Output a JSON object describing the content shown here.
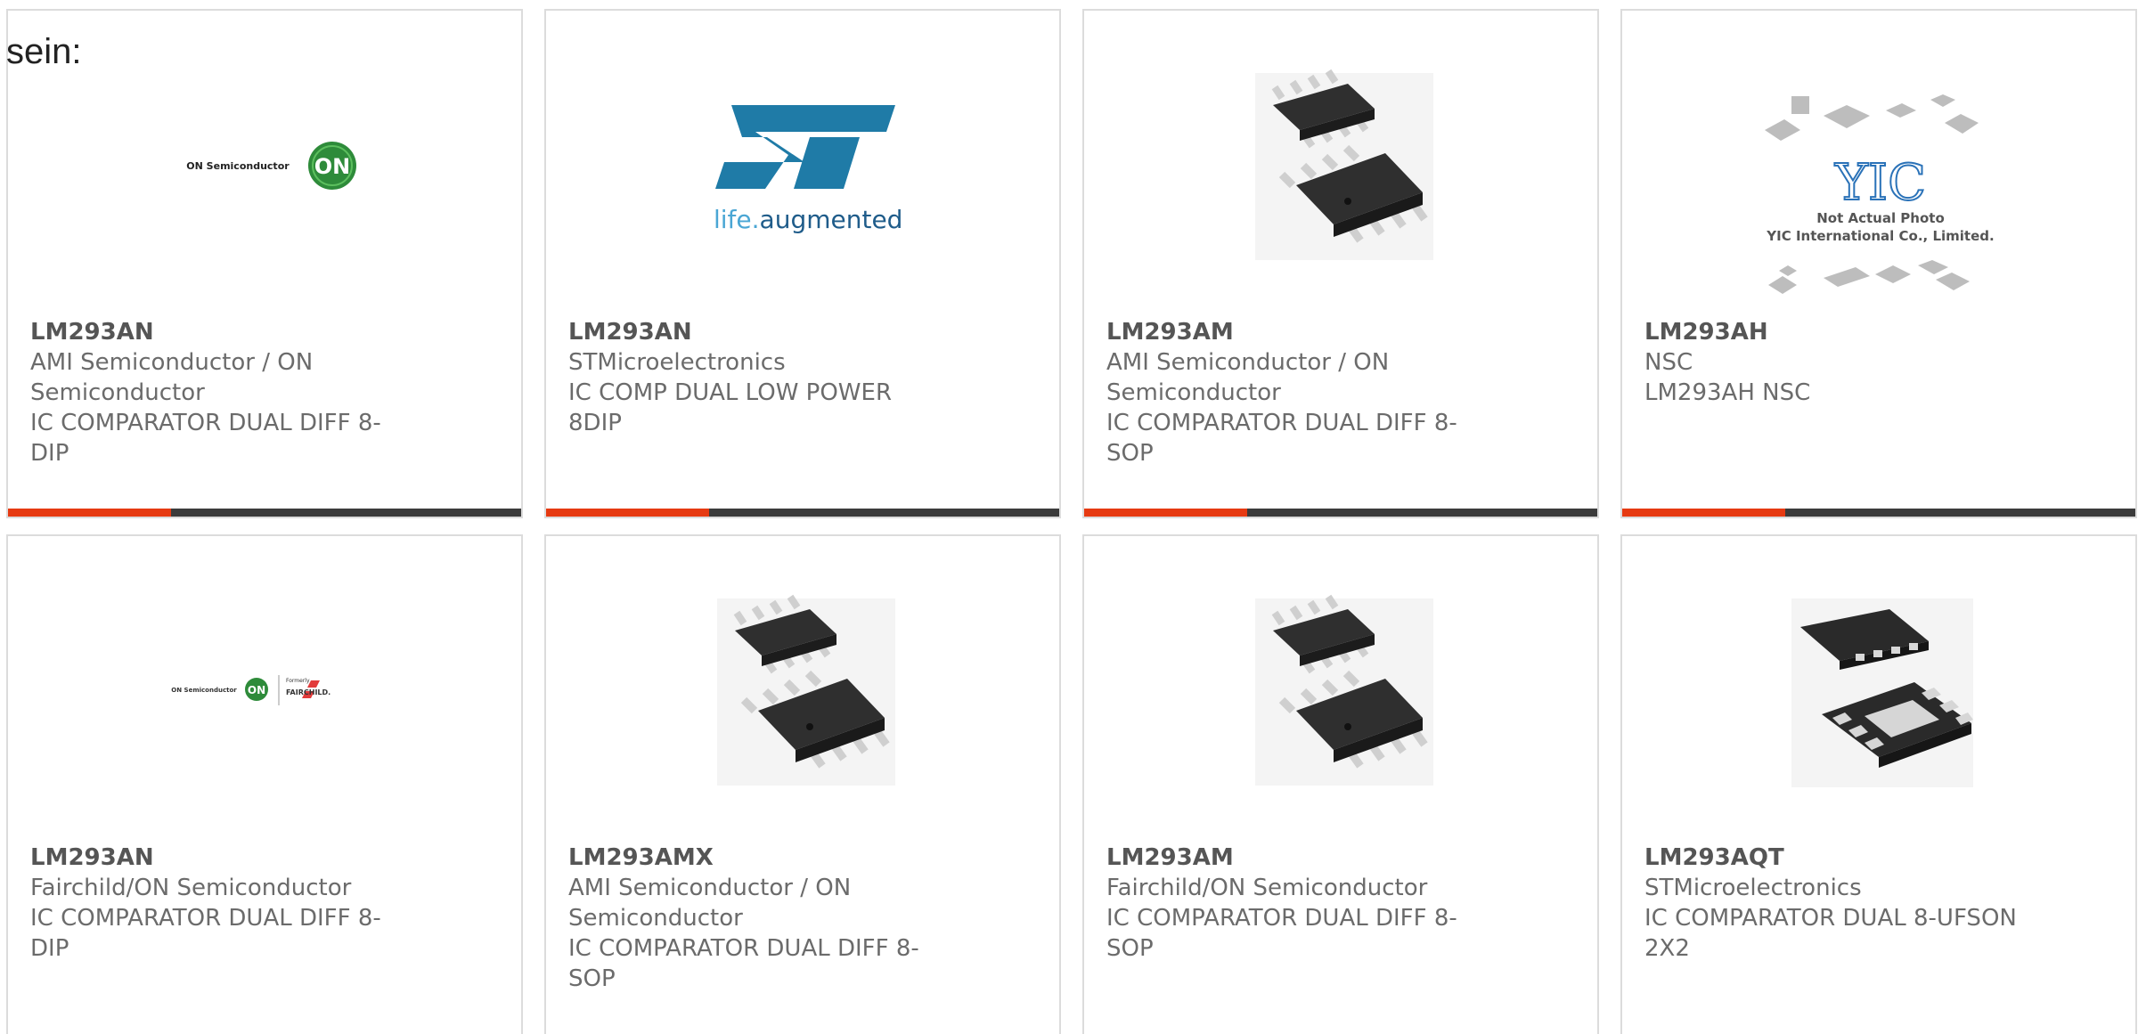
{
  "intro_text": "sein:",
  "colors": {
    "accent": "#e63a12",
    "bar": "#3b3b3b",
    "text": "#6b6b6b",
    "border": "#dcdcdc"
  },
  "products": [
    {
      "part_number": "LM293AN",
      "manufacturer": "AMI Semiconductor / ON Semiconductor",
      "description": "IC COMPARATOR DUAL DIFF 8-DIP",
      "image": "on-semiconductor-logo",
      "logo_text": "ON Semiconductor",
      "logo_mark": "ON"
    },
    {
      "part_number": "LM293AN",
      "manufacturer": "STMicroelectronics",
      "description": "IC COMP DUAL LOW POWER 8DIP",
      "image": "st-logo",
      "logo_tagline_a": "life.",
      "logo_tagline_b": "augmented"
    },
    {
      "part_number": "LM293AM",
      "manufacturer": "AMI Semiconductor / ON Semiconductor",
      "description": "IC COMPARATOR DUAL DIFF 8-SOP",
      "image": "soic-8-chip-photo"
    },
    {
      "part_number": "LM293AH",
      "manufacturer": "NSC",
      "description": "LM293AH NSC",
      "image": "yic-placeholder-photo",
      "logo_mark": "YIC",
      "caption_1": "Not Actual Photo",
      "caption_2": "YIC International Co., Limited."
    },
    {
      "part_number": "LM293AN",
      "manufacturer": "Fairchild/ON Semiconductor",
      "description": "IC COMPARATOR DUAL DIFF 8-DIP",
      "image": "on-fairchild-logo",
      "logo_text": "ON Semiconductor",
      "logo_mark": "ON",
      "formerly_text": "Formerly",
      "fairchild_text": "FAIRCHILD."
    },
    {
      "part_number": "LM293AMX",
      "manufacturer": "AMI Semiconductor / ON Semiconductor",
      "description": "IC COMPARATOR DUAL DIFF 8-SOP",
      "image": "soic-8-chip-photo"
    },
    {
      "part_number": "LM293AM",
      "manufacturer": "Fairchild/ON Semiconductor",
      "description": "IC COMPARATOR DUAL DIFF 8-SOP",
      "image": "soic-8-chip-photo"
    },
    {
      "part_number": "LM293AQT",
      "manufacturer": "STMicroelectronics",
      "description": "IC COMPARATOR DUAL 8-UFSON 2X2",
      "image": "ufson-8-chip-photo"
    }
  ]
}
